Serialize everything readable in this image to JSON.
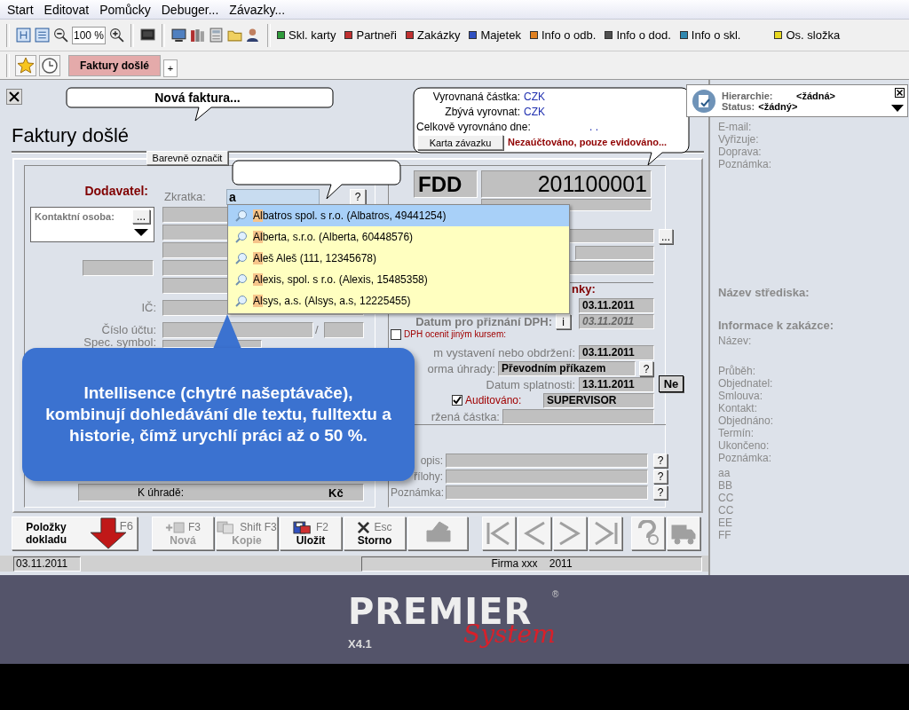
{
  "menu": [
    "Start",
    "Editovat",
    "Pomůcky",
    "Debuger...",
    "Závazky..."
  ],
  "toolbar": {
    "zoom": "100 %",
    "shortcuts": [
      {
        "label": "Skl. karty",
        "color": "#2e9a3a"
      },
      {
        "label": "Partneři",
        "color": "#c03030"
      },
      {
        "label": "Zakázky",
        "color": "#c03030"
      },
      {
        "label": "Majetek",
        "color": "#3050c0"
      },
      {
        "label": "Info o odb.",
        "color": "#e08020"
      },
      {
        "label": "Info o dod.",
        "color": "#505050"
      },
      {
        "label": "Info o skl.",
        "color": "#3088b0"
      },
      {
        "label": "Os. složka",
        "color": "#e8d820"
      }
    ]
  },
  "tabs": [
    {
      "label": "Faktury došlé",
      "selected": true
    }
  ],
  "new_tab": "+",
  "form": {
    "title": "Faktury došlé",
    "new_hint": "Nová faktura...",
    "color_tab": "Barevně označit",
    "supplier_label": "Dodavatel:",
    "zkratka": {
      "label": "Zkratka:",
      "value": "a",
      "help": "?"
    },
    "contact": {
      "label": "Kontaktní osoba:",
      "button": "..."
    },
    "suggestions": [
      {
        "match": "Al",
        "text": "batros spol. s r.o. (Albatros, 49441254)",
        "selected": true
      },
      {
        "match": "Al",
        "text": "berta, s.r.o. (Alberta, 60448576)",
        "selected": false
      },
      {
        "match": "Al",
        "text": "eš Aleš (111, 12345678)",
        "selected": false
      },
      {
        "match": "Al",
        "text": "exis, spol. s r.o. (Alexis, 15485358)",
        "selected": false
      },
      {
        "match": "Al",
        "text": "sys, a.s. (Alsys, a.s, 12225455)",
        "selected": false
      }
    ],
    "ico_label": "IČ:",
    "account": {
      "label": "Číslo účtu:",
      "separator": "/"
    },
    "spec_label": "Spec. symbol:",
    "to_pay": {
      "label": "K úhradě:",
      "currency": "Kč"
    },
    "doc": {
      "series": "FDD",
      "number": "201100001",
      "more": "..."
    },
    "settlement": {
      "rows": [
        {
          "label": "Vyrovnaná částka:",
          "value": "CZK"
        },
        {
          "label": "Zbývá vyrovnat:",
          "value": "CZK"
        },
        {
          "label": "Celkově vyrovnáno dne:",
          "value": ". ."
        }
      ],
      "button": "Karta závazku",
      "status": "Nezaúčtováno, pouze evidováno..."
    },
    "partial_label": "nky:",
    "date1": "03.11.2011",
    "vat_date": {
      "label": "Datum pro přiznání DPH:",
      "button": "i",
      "value": "03.11.2011"
    },
    "other_rate": {
      "label": "DPH ocenit jiným kursem:",
      "checked": false
    },
    "issue_date": {
      "label": "m vystavení nebo obdržení:",
      "value": "03.11.2011"
    },
    "payment": {
      "label": "orma úhrady:",
      "value": "Převodním příkazem",
      "help": "?"
    },
    "due": {
      "label": "Datum splatnosti:",
      "value": "13.11.2011",
      "button": "Ne"
    },
    "audited": {
      "label": "Auditováno:",
      "checked": true,
      "value": "SUPERVISOR"
    },
    "held_label": "ržená částka:",
    "notes": [
      {
        "label": "opis:",
        "help": "?"
      },
      {
        "label": "řílohy:",
        "help": "?"
      },
      {
        "label": "Poznámka:",
        "help": "?"
      }
    ]
  },
  "tooltip": "Intellisence (chytré našeptávače), kombinují dohledávání dle textu, fulltextu a historie, čímž urychlí práci až o 50 %.",
  "actions": [
    {
      "kind": "items",
      "label": "Položky dokladu",
      "key": "F6",
      "disabled": false
    },
    {
      "kind": "new",
      "label": "Nová",
      "key": "F3",
      "disabled": true
    },
    {
      "kind": "copy",
      "label": "Kopie",
      "key": "Shift F3",
      "disabled": true
    },
    {
      "kind": "save",
      "label": "Uložit",
      "key": "F2",
      "disabled": false
    },
    {
      "kind": "cancel",
      "label": "Storno",
      "key": "Esc",
      "disabled": false
    },
    {
      "kind": "print",
      "disabled": true
    },
    {
      "kind": "first",
      "disabled": true
    },
    {
      "kind": "prev",
      "disabled": true
    },
    {
      "kind": "next",
      "disabled": true
    },
    {
      "kind": "last",
      "disabled": true
    },
    {
      "kind": "help",
      "disabled": true
    },
    {
      "kind": "truck",
      "disabled": true
    }
  ],
  "status_bar": {
    "date": "03.11.2011",
    "company": "Firma xxx",
    "year": "2011"
  },
  "side_popup": {
    "rows": [
      {
        "label": "Hierarchie:",
        "value": "<žádná>"
      },
      {
        "label": "Status:",
        "value": "<žádný>"
      }
    ]
  },
  "side_panel": {
    "contact_fields": [
      "E-mail:",
      "Vyřizuje:",
      "Doprava:",
      "Poznámka:"
    ],
    "center_label": "Název střediska:",
    "order_heading": "Informace k zakázce:",
    "order_name": "Název:",
    "order_fields": [
      "Průběh:",
      "Objednatel:",
      "Smlouva:",
      "Kontakt:",
      "Objednáno:",
      "Termín:",
      "Ukončeno:",
      "Poznámka:"
    ],
    "notes": [
      "aa",
      "BB",
      "CC",
      "CC",
      "EE",
      "FF"
    ]
  },
  "branding": {
    "logo": "PREMIER",
    "script": "System",
    "mark": "®",
    "version": "X4.1"
  }
}
